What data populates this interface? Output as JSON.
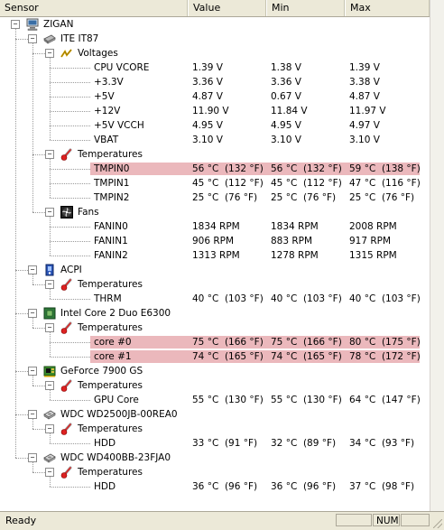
{
  "columns": [
    "Sensor",
    "Value",
    "Min",
    "Max"
  ],
  "rows": [
    {
      "depth": 0,
      "icon": "computer-icon",
      "label": "ZIGAN",
      "value": "",
      "min": "",
      "max": ""
    },
    {
      "depth": 1,
      "icon": "chip-icon",
      "label": "ITE IT87",
      "value": "",
      "min": "",
      "max": ""
    },
    {
      "depth": 2,
      "icon": "voltage-icon",
      "label": "Voltages",
      "value": "",
      "min": "",
      "max": ""
    },
    {
      "depth": 3,
      "icon": "",
      "label": "CPU VCORE",
      "value": "1.39 V",
      "min": "1.38 V",
      "max": "1.39 V"
    },
    {
      "depth": 3,
      "icon": "",
      "label": "+3.3V",
      "value": "3.36 V",
      "min": "3.36 V",
      "max": "3.38 V"
    },
    {
      "depth": 3,
      "icon": "",
      "label": "+5V",
      "value": "4.87 V",
      "min": "0.67 V",
      "max": "4.87 V"
    },
    {
      "depth": 3,
      "icon": "",
      "label": "+12V",
      "value": "11.90 V",
      "min": "11.84 V",
      "max": "11.97 V"
    },
    {
      "depth": 3,
      "icon": "",
      "label": "+5V VCCH",
      "value": "4.95 V",
      "min": "4.95 V",
      "max": "4.97 V"
    },
    {
      "depth": 3,
      "icon": "",
      "label": "VBAT",
      "value": "3.10 V",
      "min": "3.10 V",
      "max": "3.10 V"
    },
    {
      "depth": 2,
      "icon": "thermometer-icon",
      "label": "Temperatures",
      "value": "",
      "min": "",
      "max": ""
    },
    {
      "depth": 3,
      "icon": "",
      "label": "TMPIN0",
      "value": "56 °C  (132 °F)",
      "min": "56 °C  (132 °F)",
      "max": "59 °C  (138 °F)",
      "highlight": true
    },
    {
      "depth": 3,
      "icon": "",
      "label": "TMPIN1",
      "value": "45 °C  (112 °F)",
      "min": "45 °C  (112 °F)",
      "max": "47 °C  (116 °F)"
    },
    {
      "depth": 3,
      "icon": "",
      "label": "TMPIN2",
      "value": "25 °C  (76 °F)",
      "min": "25 °C  (76 °F)",
      "max": "25 °C  (76 °F)"
    },
    {
      "depth": 2,
      "icon": "fan-icon",
      "label": "Fans",
      "value": "",
      "min": "",
      "max": ""
    },
    {
      "depth": 3,
      "icon": "",
      "label": "FANIN0",
      "value": "1834 RPM",
      "min": "1834 RPM",
      "max": "2008 RPM"
    },
    {
      "depth": 3,
      "icon": "",
      "label": "FANIN1",
      "value": "906 RPM",
      "min": "883 RPM",
      "max": "917 RPM"
    },
    {
      "depth": 3,
      "icon": "",
      "label": "FANIN2",
      "value": "1313 RPM",
      "min": "1278 RPM",
      "max": "1315 RPM"
    },
    {
      "depth": 1,
      "icon": "acpi-icon",
      "label": "ACPI",
      "value": "",
      "min": "",
      "max": ""
    },
    {
      "depth": 2,
      "icon": "thermometer-icon",
      "label": "Temperatures",
      "value": "",
      "min": "",
      "max": ""
    },
    {
      "depth": 3,
      "icon": "",
      "label": "THRM",
      "value": "40 °C  (103 °F)",
      "min": "40 °C  (103 °F)",
      "max": "40 °C  (103 °F)"
    },
    {
      "depth": 1,
      "icon": "cpu-icon",
      "label": "Intel Core 2 Duo E6300",
      "value": "",
      "min": "",
      "max": ""
    },
    {
      "depth": 2,
      "icon": "thermometer-icon",
      "label": "Temperatures",
      "value": "",
      "min": "",
      "max": ""
    },
    {
      "depth": 3,
      "icon": "",
      "label": "core #0",
      "value": "75 °C  (166 °F)",
      "min": "75 °C  (166 °F)",
      "max": "80 °C  (175 °F)",
      "highlight": true
    },
    {
      "depth": 3,
      "icon": "",
      "label": "core #1",
      "value": "74 °C  (165 °F)",
      "min": "74 °C  (165 °F)",
      "max": "78 °C  (172 °F)",
      "highlight": true
    },
    {
      "depth": 1,
      "icon": "gpu-icon",
      "label": "GeForce 7900 GS",
      "value": "",
      "min": "",
      "max": ""
    },
    {
      "depth": 2,
      "icon": "thermometer-icon",
      "label": "Temperatures",
      "value": "",
      "min": "",
      "max": ""
    },
    {
      "depth": 3,
      "icon": "",
      "label": "GPU Core",
      "value": "55 °C  (130 °F)",
      "min": "55 °C  (130 °F)",
      "max": "64 °C  (147 °F)"
    },
    {
      "depth": 1,
      "icon": "hdd-icon",
      "label": "WDC WD2500JB-00REA0",
      "value": "",
      "min": "",
      "max": ""
    },
    {
      "depth": 2,
      "icon": "thermometer-icon",
      "label": "Temperatures",
      "value": "",
      "min": "",
      "max": ""
    },
    {
      "depth": 3,
      "icon": "",
      "label": "HDD",
      "value": "33 °C  (91 °F)",
      "min": "32 °C  (89 °F)",
      "max": "34 °C  (93 °F)"
    },
    {
      "depth": 1,
      "icon": "hdd-icon",
      "label": "WDC WD400BB-23FJA0",
      "value": "",
      "min": "",
      "max": ""
    },
    {
      "depth": 2,
      "icon": "thermometer-icon",
      "label": "Temperatures",
      "value": "",
      "min": "",
      "max": ""
    },
    {
      "depth": 3,
      "icon": "",
      "label": "HDD",
      "value": "36 °C  (96 °F)",
      "min": "36 °C  (96 °F)",
      "max": "37 °C  (98 °F)"
    }
  ],
  "statusbar": {
    "text": "Ready",
    "num": "NUM"
  },
  "colors": {
    "highlight": "#ebb8bc",
    "chrome": "#ece9d8"
  }
}
